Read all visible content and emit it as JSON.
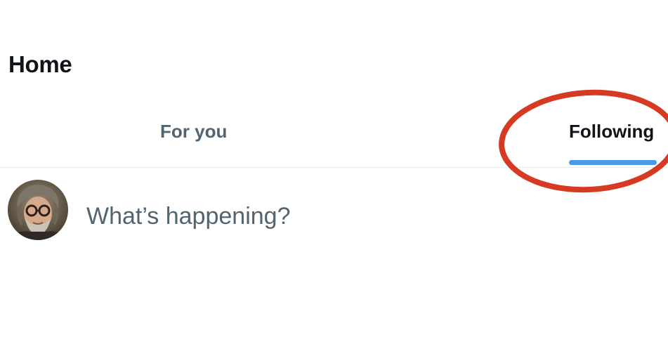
{
  "header": {
    "title": "Home"
  },
  "tabs": [
    {
      "label": "For you",
      "selected": false
    },
    {
      "label": "Following",
      "selected": true
    }
  ],
  "composer": {
    "placeholder": "What’s happening?"
  },
  "colors": {
    "accent": "#4a99e9",
    "annotation": "#d63a22",
    "muted_text": "#536471",
    "primary_text": "#0f1419",
    "divider": "#e6ecf0"
  },
  "icons": {
    "avatar": "user-avatar-photo"
  }
}
